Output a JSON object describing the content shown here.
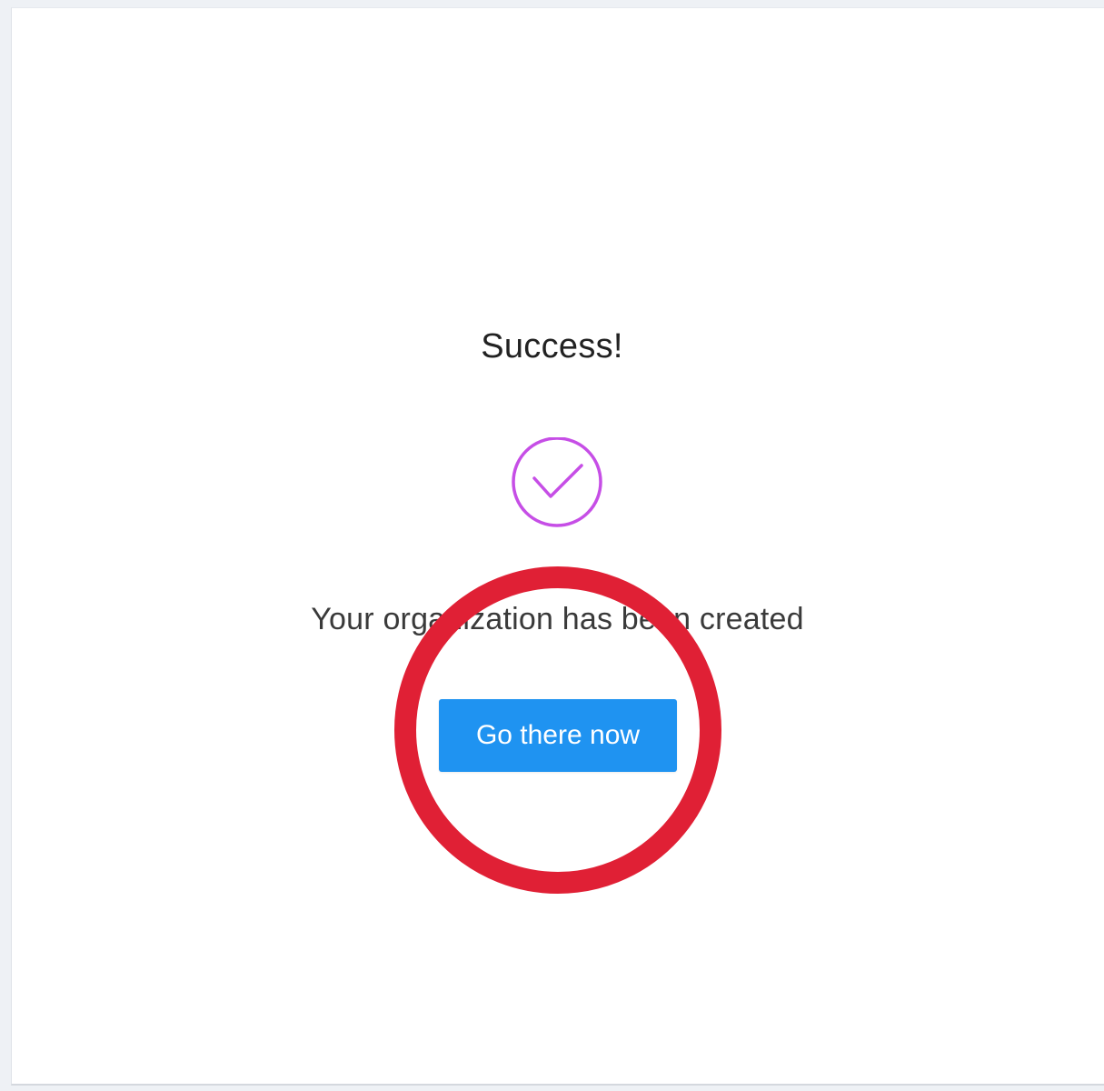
{
  "dialog": {
    "title": "Success!",
    "icon": "check-circle-icon",
    "message": "Your organization has been created",
    "cta_label": "Go there now"
  },
  "colors": {
    "check_icon": "#c64ee6",
    "button_bg": "#1f93f1",
    "button_text": "#ffffff",
    "annotation_ring": "#e02035"
  }
}
